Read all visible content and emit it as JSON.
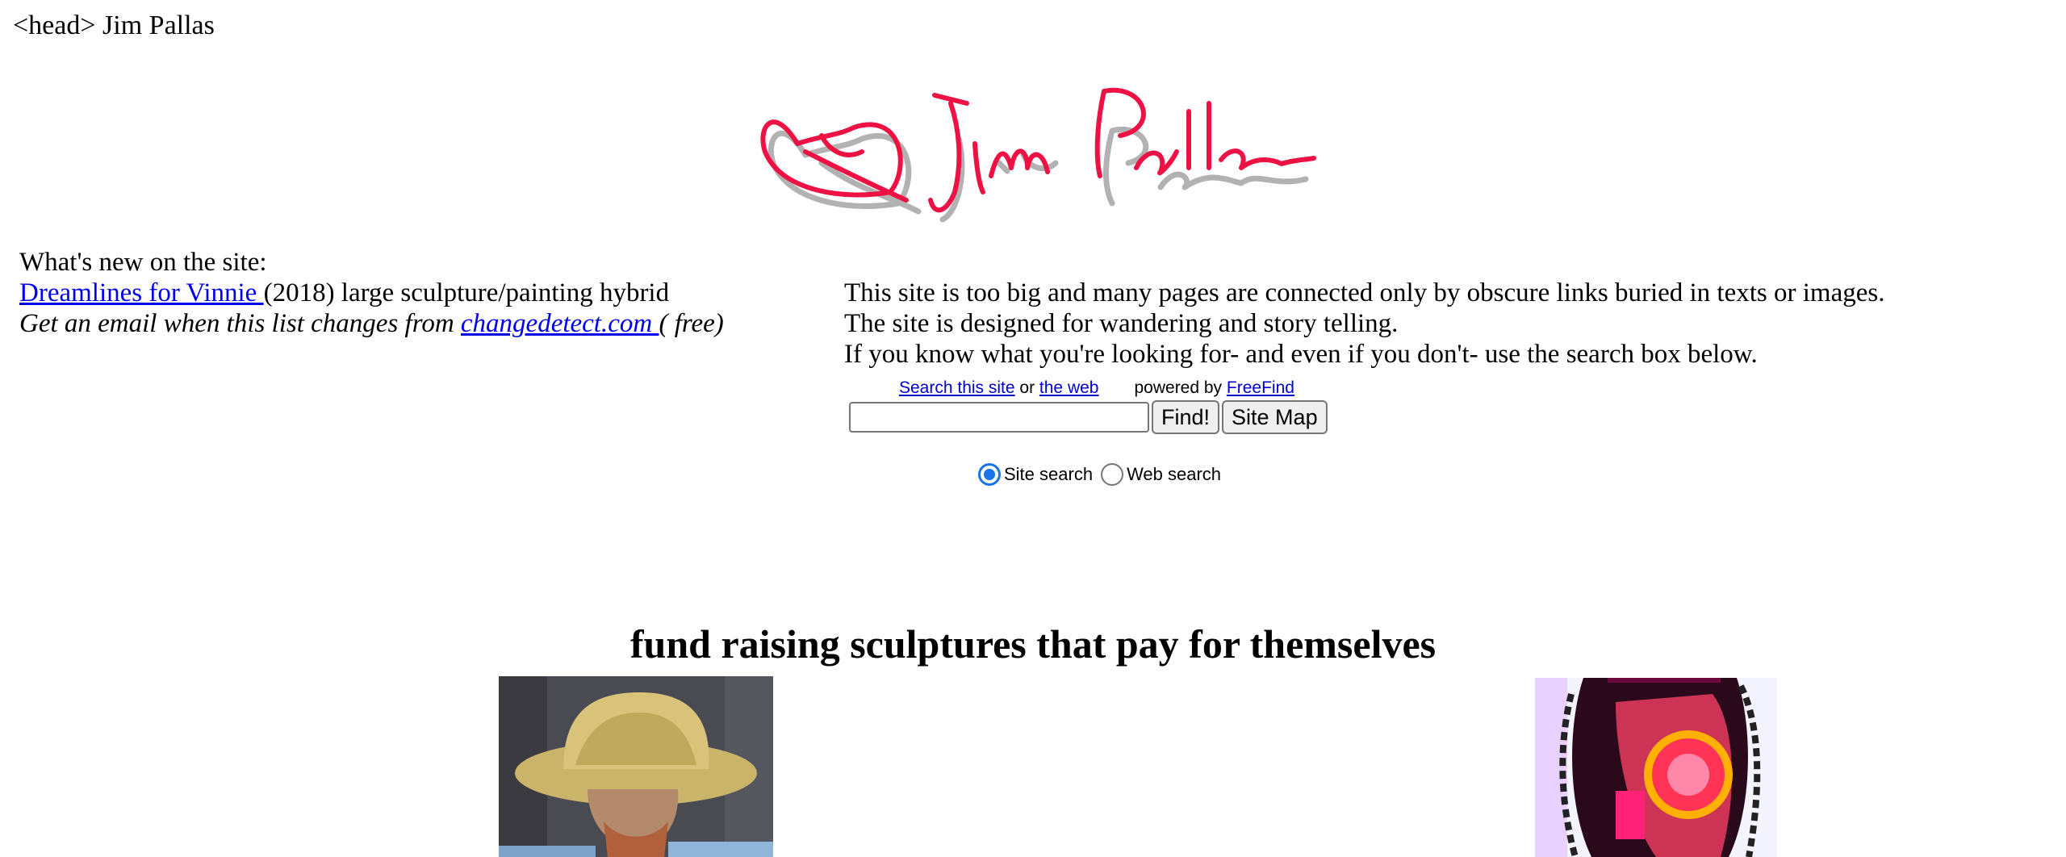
{
  "page": {
    "head_text": "<head> Jim Pallas"
  },
  "logo": {
    "alt": "Jim Pallas",
    "colors": {
      "ink": "#ee1144",
      "shadow": "#aaaaaa"
    }
  },
  "whats_new": {
    "heading": "What's new on the site:",
    "item_link": "Dreamlines for Vinnie ",
    "item_desc": " (2018) large sculpture/painting hybrid",
    "email_prefix": "Get an email when this list changes from ",
    "email_link": "changedetect.com ",
    "email_suffix": " ( free)"
  },
  "intro": {
    "line1": "This site is too big and many pages are connected only by obscure links buried in texts or images.",
    "line2": "The site is designed for wandering and story telling.",
    "line3": " If you know what you're looking for- and even if you don't- use the search box below."
  },
  "search": {
    "search_site_link": "Search this site",
    "or_text": " or ",
    "web_link": "the web",
    "powered_by": "powered by ",
    "freefind_link": "FreeFind",
    "input_value": "",
    "find_button": "Find!",
    "sitemap_button": "Site Map",
    "site_search_label": "Site search",
    "web_search_label": "Web search",
    "selected": "Site search"
  },
  "fund": {
    "title": "fund raising sculptures that pay for themselves"
  }
}
